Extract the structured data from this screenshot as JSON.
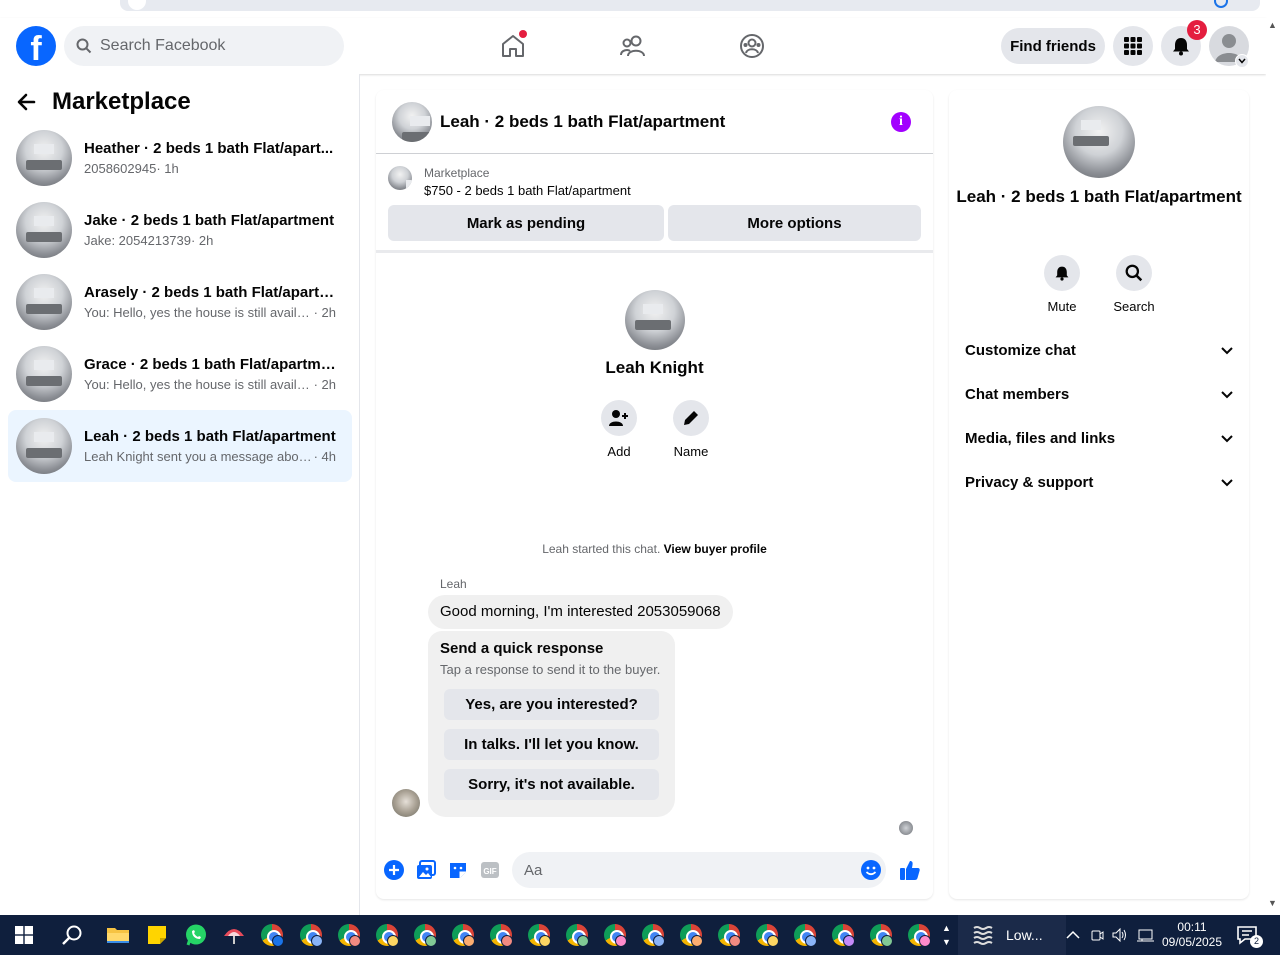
{
  "header": {
    "search_placeholder": "Search Facebook",
    "find_friends": "Find friends",
    "notifications_count": "3"
  },
  "left": {
    "title": "Marketplace",
    "conversations": [
      {
        "title": "Heather · 2 beds 1 bath Flat/apart...",
        "snippet": "2058602945",
        "time": " · 1h",
        "active": false
      },
      {
        "title": "Jake · 2 beds 1 bath Flat/apartment",
        "snippet": "Jake: 2054213739",
        "time": " · 2h",
        "active": false
      },
      {
        "title": "Arasely · 2 beds 1 bath Flat/apartm...",
        "snippet": "You: Hello, yes the house is still availa...",
        "time": " · 2h",
        "active": false
      },
      {
        "title": "Grace · 2 beds 1 bath Flat/apartment",
        "snippet": "You: Hello, yes the house is still availa...",
        "time": " · 2h",
        "active": false
      },
      {
        "title": "Leah · 2 beds 1 bath Flat/apartment",
        "snippet": "Leah Knight sent you a message abou...",
        "time": " · 4h",
        "active": true
      }
    ]
  },
  "chat": {
    "title": "Leah · 2 beds 1 bath Flat/apartment",
    "marketplace_label": "Marketplace",
    "listing": "$750 - 2 beds 1 bath Flat/apartment",
    "mark_pending": "Mark as pending",
    "more_options": "More options",
    "contact_name": "Leah Knight",
    "add_label": "Add",
    "name_label": "Name",
    "started_text": "Leah started this chat.",
    "view_profile": "View buyer profile",
    "sender": "Leah",
    "message": "Good morning, I'm interested 2053059068",
    "quick_title": "Send a quick response",
    "quick_sub": "Tap a response to send it to the buyer.",
    "quick_options": [
      "Yes, are you interested?",
      "In talks. I'll let you know.",
      "Sorry, it's not available."
    ],
    "composer_placeholder": "Aa"
  },
  "details": {
    "title": "Leah · 2 beds 1 bath Flat/apartment",
    "mute": "Mute",
    "search": "Search",
    "sections": [
      "Customize chat",
      "Chat members",
      "Media, files and links",
      "Privacy & support"
    ]
  },
  "taskbar": {
    "weather": "Low...",
    "time": "00:11",
    "date": "09/05/2025",
    "notif_count": "2"
  },
  "colors": {
    "brand": "#0866ff",
    "info": "#a200ff",
    "badge": "#e41e3f",
    "active_row": "#ebf5ff"
  }
}
